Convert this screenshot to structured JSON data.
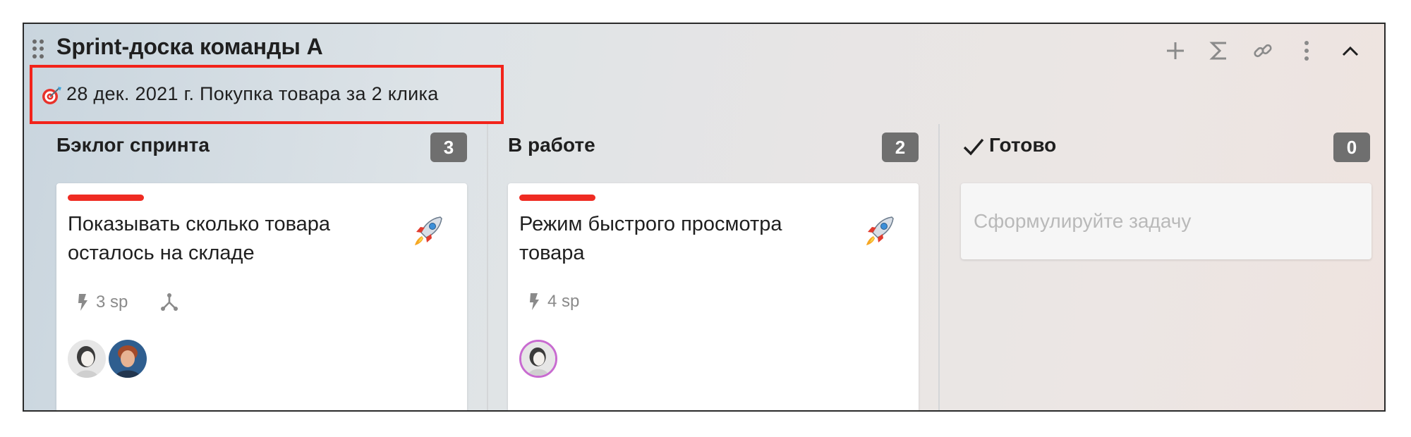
{
  "board": {
    "title": "Sprint-доска команды А",
    "goal_icon": "target-icon",
    "goal_text": "28 дек. 2021 г. Покупка товара за 2 клика",
    "highlight_color": "#f2231a",
    "toolbar": [
      {
        "name": "add-icon"
      },
      {
        "name": "sigma-icon"
      },
      {
        "name": "link-icon"
      },
      {
        "name": "more-vertical-icon"
      },
      {
        "name": "collapse-chevron-icon"
      }
    ]
  },
  "columns": [
    {
      "title": "Бэклог спринта",
      "count": "3",
      "card": {
        "title": "Показывать сколько товара осталось на складе",
        "priority_color": "#ef2b22",
        "icon": "rocket-icon",
        "story_points": "3 sp",
        "has_subtasks_icon": true,
        "avatars": 2
      }
    },
    {
      "title": "В работе",
      "count": "2",
      "card": {
        "title": "Режим быстрого просмотра товара",
        "priority_color": "#ef2b22",
        "icon": "rocket-icon",
        "story_points": "4 sp",
        "has_subtasks_icon": false,
        "avatars": 1
      }
    },
    {
      "title": "Готово",
      "title_icon": "check-icon",
      "count": "0",
      "new_task_placeholder": "Сформулируйте задачу"
    }
  ]
}
